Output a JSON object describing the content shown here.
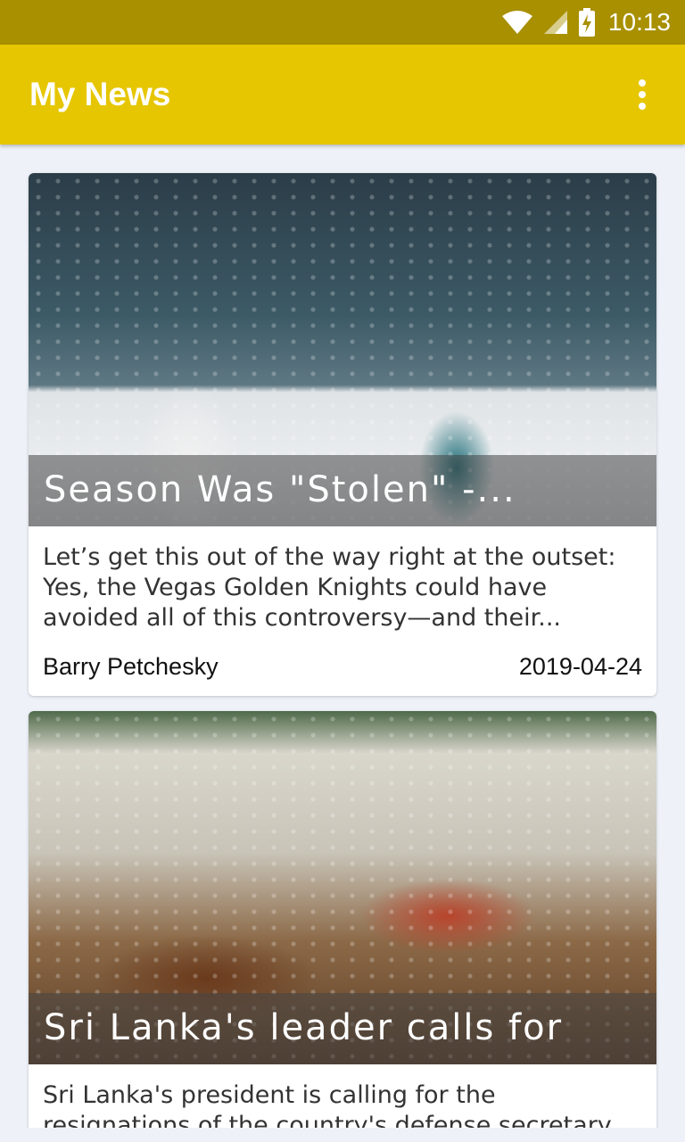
{
  "status_bar": {
    "time": "10:13",
    "icons": [
      "wifi-icon",
      "signal-icon",
      "battery-charging-icon"
    ]
  },
  "app_bar": {
    "title": "My News",
    "menu_icon": "more-vert-icon"
  },
  "colors": {
    "status_bar": "#a89000",
    "app_bar": "#e6c600",
    "background": "#eef2f8"
  },
  "articles": [
    {
      "headline": "Season Was \"Stolen\" -...",
      "summary": "Let’s get this out of the way right at the outset: Yes, the Vegas Golden Knights could have avoided all of this controversy—and their...",
      "author": "Barry Petchesky",
      "date": "2019-04-24"
    },
    {
      "headline": "Sri Lanka's leader calls for",
      "summary": "Sri Lanka's president is calling for the resignations of the country's defense secretary",
      "author": "",
      "date": ""
    }
  ]
}
